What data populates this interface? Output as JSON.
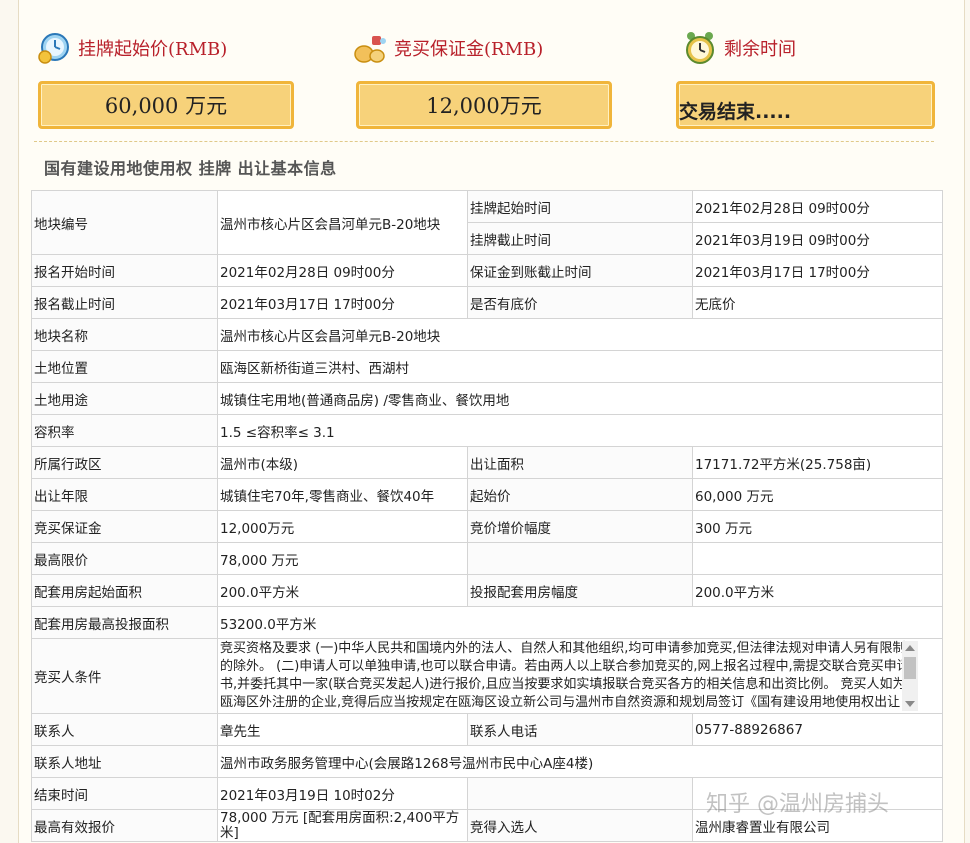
{
  "header": {
    "start_price_label": "挂牌起始价(RMB)",
    "deposit_label": "竞买保证金(RMB)",
    "time_label": "剩余时间",
    "start_price_value": "60,000 万元",
    "deposit_value": "12,000万元",
    "time_value": "交易结束....."
  },
  "section_title": "国有建设用地使用权 挂牌 出让基本信息",
  "rows": {
    "plot_no_label": "地块编号",
    "plot_no": "温州市核心片区会昌河单元B-20地块",
    "list_start_label": "挂牌起始时间",
    "list_start": "2021年02月28日 09时00分",
    "list_end_label": "挂牌截止时间",
    "list_end": "2021年03月19日 09时00分",
    "reg_start_label": "报名开始时间",
    "reg_start": "2021年02月28日 09时00分",
    "deposit_deadline_label": "保证金到账截止时间",
    "deposit_deadline": "2021年03月17日 17时00分",
    "reg_end_label": "报名截止时间",
    "reg_end": "2021年03月17日 17时00分",
    "reserve_label": "是否有底价",
    "reserve": "无底价",
    "plot_name_label": "地块名称",
    "plot_name": "温州市核心片区会昌河单元B-20地块",
    "location_label": "土地位置",
    "location": "瓯海区新桥街道三洪村、西湖村",
    "usage_label": "土地用途",
    "usage": "城镇住宅用地(普通商品房) /零售商业、餐饮用地",
    "far_label": "容积率",
    "far": "1.5 ≤容积率≤ 3.1",
    "district_label": "所属行政区",
    "district": "温州市(本级)",
    "area_label": "出让面积",
    "area": "17171.72平方米(25.758亩)",
    "term_label": "出让年限",
    "term": "城镇住宅70年,零售商业、餐饮40年",
    "start_price_label": "起始价",
    "start_price": "60,000 万元",
    "deposit_label": "竞买保证金",
    "deposit": "12,000万元",
    "increment_label": "竞价增价幅度",
    "increment": "300 万元",
    "cap_label": "最高限价",
    "cap": "78,000 万元",
    "housing_start_label": "配套用房起始面积",
    "housing_start": "200.0平方米",
    "housing_inc_label": "投报配套用房幅度",
    "housing_inc": "200.0平方米",
    "housing_max_label": "配套用房最高投报面积",
    "housing_max": "53200.0平方米",
    "conditions_label": "竞买人条件",
    "conditions": "竞买资格及要求 (一)中华人民共和国境内外的法人、自然人和其他组织,均可申请参加竞买,但法律法规对申请人另有限制的除外。 (二)申请人可以单独申请,也可以联合申请。若由两人以上联合参加竞买的,网上报名过程中,需提交联合竞买申请书,并委托其中一家(联合竞买发起人)进行报价,且应当按要求如实填报联合竞买各方的相关信息和出资比例。 竞买人如为瓯海区外注册的企业,竞得后应当按规定在瓯海区设立新公司与温州市自然资源和规划局签订《国有建设用地使用权出让合同》",
    "contact_label": "联系人",
    "contact": "章先生",
    "phone_label": "联系人电话",
    "phone": "0577-88926867",
    "address_label": "联系人地址",
    "address": "温州市政务服务管理中心(会展路1268号温州市民中心A座4楼)",
    "end_time_label": "结束时间",
    "end_time": "2021年03月19日 10时02分",
    "best_offer_label": "最高有效报价",
    "best_offer": "78,000 万元 [配套用房面积:2,400平方米]",
    "winner_label": "竞得入选人",
    "winner": "温州康睿置业有限公司"
  },
  "watermark": "知乎 @温州房捕头"
}
